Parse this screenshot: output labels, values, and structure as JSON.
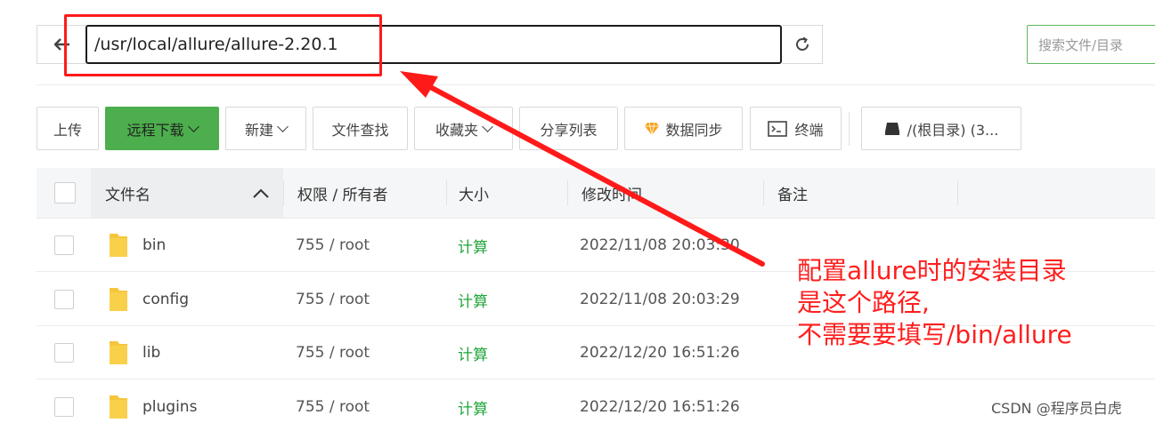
{
  "address_bar": {
    "path": "/usr/local/allure/allure-2.20.1",
    "search_placeholder": "搜索文件/目录"
  },
  "toolbar": {
    "upload": "上传",
    "remote_download": "远程下载",
    "new": "新建",
    "file_search": "文件查找",
    "favorites": "收藏夹",
    "share_list": "分享列表",
    "data_sync": "数据同步",
    "terminal": "终端",
    "disk": "/(根目录) (3..."
  },
  "table": {
    "headers": {
      "name": "文件名",
      "perm": "权限 / 所有者",
      "size": "大小",
      "mtime": "修改时间",
      "note": "备注"
    },
    "rows": [
      {
        "name": "bin",
        "perm": "755 / root",
        "size": "计算",
        "mtime": "2022/11/08 20:03:30"
      },
      {
        "name": "config",
        "perm": "755 / root",
        "size": "计算",
        "mtime": "2022/11/08 20:03:29"
      },
      {
        "name": "lib",
        "perm": "755 / root",
        "size": "计算",
        "mtime": "2022/12/20 16:51:26"
      },
      {
        "name": "plugins",
        "perm": "755 / root",
        "size": "计算",
        "mtime": "2022/12/20 16:51:26"
      }
    ]
  },
  "annotation": {
    "line1": "配置allure时的安装目录",
    "line2": "是这个路径,",
    "line3": "不需要要填写/bin/allure"
  },
  "watermark": "CSDN @程序员白虎",
  "colors": {
    "accent_green": "#20a53a",
    "button_green": "#4cae4c",
    "annotation_red": "#ff1a1a",
    "folder_yellow": "#f5c63c"
  }
}
